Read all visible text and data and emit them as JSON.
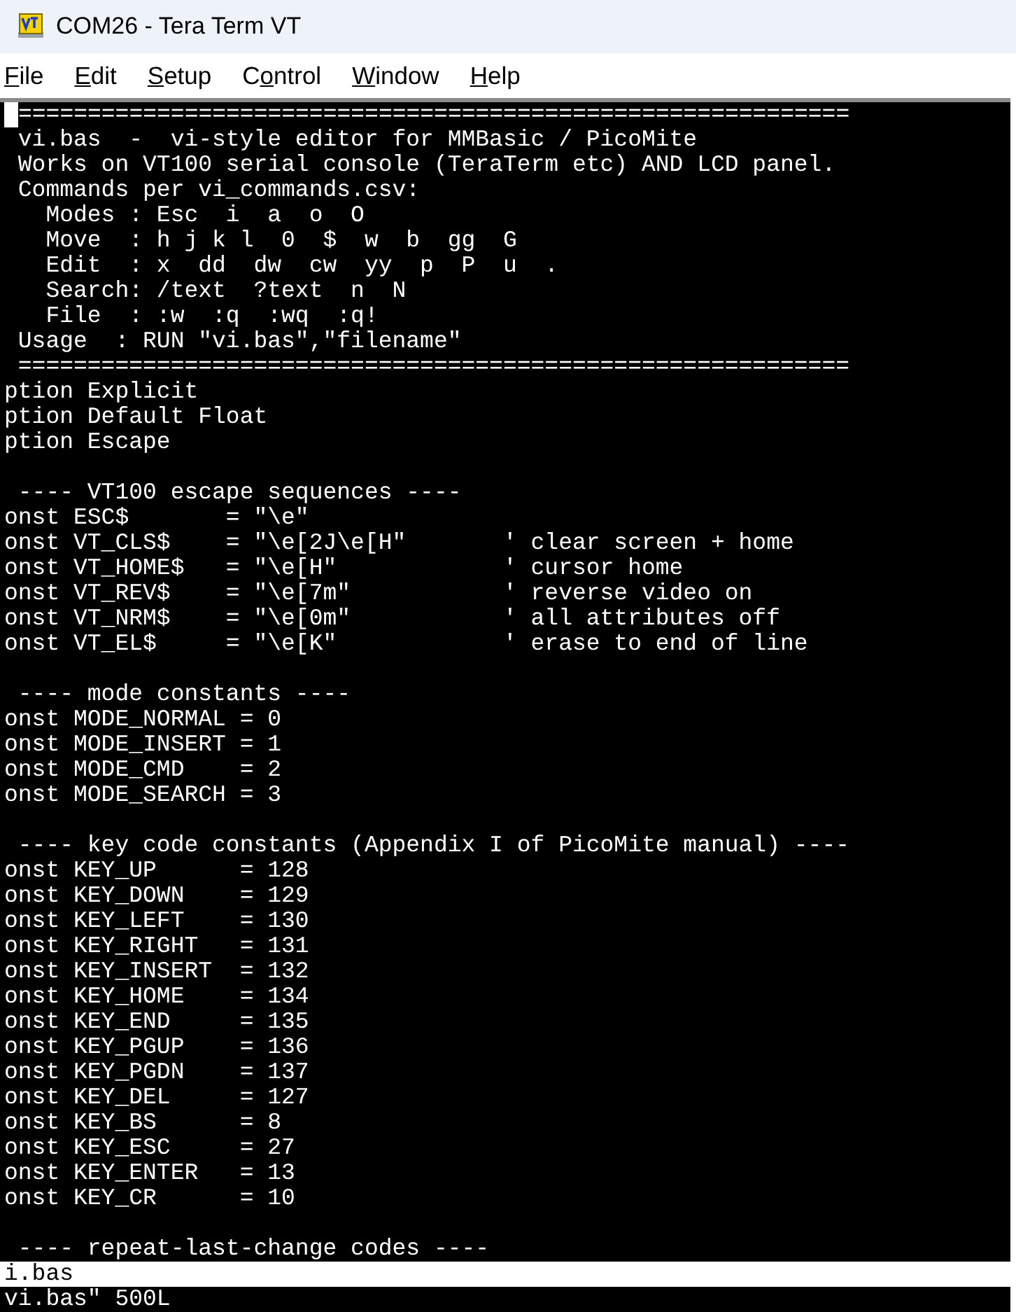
{
  "window": {
    "title": "COM26 - Tera Term VT"
  },
  "menu": [
    {
      "key": "F",
      "post": "ile"
    },
    {
      "key": "E",
      "post": "dit"
    },
    {
      "key": "S",
      "post": "etup"
    },
    {
      "pre": "C",
      "key": "o",
      "post": "ntrol"
    },
    {
      "key": "W",
      "post": "indow"
    },
    {
      "key": "H",
      "post": "elp"
    }
  ],
  "terminal": {
    "lines": [
      {
        "kind": "cursor_line",
        "text": "============================================================"
      },
      {
        "kind": "text",
        "text": " vi.bas  -  vi-style editor for MMBasic / PicoMite"
      },
      {
        "kind": "text",
        "text": " Works on VT100 serial console (TeraTerm etc) AND LCD panel."
      },
      {
        "kind": "text",
        "text": " Commands per vi_commands.csv:"
      },
      {
        "kind": "text",
        "text": "   Modes : Esc  i  a  o  O"
      },
      {
        "kind": "text",
        "text": "   Move  : h j k l  0  $  w  b  gg  G"
      },
      {
        "kind": "text",
        "text": "   Edit  : x  dd  dw  cw  yy  p  P  u  ."
      },
      {
        "kind": "text",
        "text": "   Search: /text  ?text  n  N"
      },
      {
        "kind": "text",
        "text": "   File  : :w  :q  :wq  :q!"
      },
      {
        "kind": "text",
        "text": " Usage  : RUN \"vi.bas\",\"filename\""
      },
      {
        "kind": "text",
        "text": " ============================================================"
      },
      {
        "kind": "text",
        "text": "ption Explicit"
      },
      {
        "kind": "text",
        "text": "ption Default Float"
      },
      {
        "kind": "text",
        "text": "ption Escape"
      },
      {
        "kind": "blank"
      },
      {
        "kind": "text",
        "text": " ---- VT100 escape sequences ----"
      },
      {
        "kind": "text",
        "text": "onst ESC$       = \"\\e\""
      },
      {
        "kind": "text",
        "text": "onst VT_CLS$    = \"\\e[2J\\e[H\"       ' clear screen + home"
      },
      {
        "kind": "text",
        "text": "onst VT_HOME$   = \"\\e[H\"            ' cursor home"
      },
      {
        "kind": "text",
        "text": "onst VT_REV$    = \"\\e[7m\"           ' reverse video on"
      },
      {
        "kind": "text",
        "text": "onst VT_NRM$    = \"\\e[0m\"           ' all attributes off"
      },
      {
        "kind": "text",
        "text": "onst VT_EL$     = \"\\e[K\"            ' erase to end of line"
      },
      {
        "kind": "blank"
      },
      {
        "kind": "text",
        "text": " ---- mode constants ----"
      },
      {
        "kind": "text",
        "text": "onst MODE_NORMAL = 0"
      },
      {
        "kind": "text",
        "text": "onst MODE_INSERT = 1"
      },
      {
        "kind": "text",
        "text": "onst MODE_CMD    = 2"
      },
      {
        "kind": "text",
        "text": "onst MODE_SEARCH = 3"
      },
      {
        "kind": "blank"
      },
      {
        "kind": "text",
        "text": " ---- key code constants (Appendix I of PicoMite manual) ----"
      },
      {
        "kind": "text",
        "text": "onst KEY_UP      = 128"
      },
      {
        "kind": "text",
        "text": "onst KEY_DOWN    = 129"
      },
      {
        "kind": "text",
        "text": "onst KEY_LEFT    = 130"
      },
      {
        "kind": "text",
        "text": "onst KEY_RIGHT   = 131"
      },
      {
        "kind": "text",
        "text": "onst KEY_INSERT  = 132"
      },
      {
        "kind": "text",
        "text": "onst KEY_HOME    = 134"
      },
      {
        "kind": "text",
        "text": "onst KEY_END     = 135"
      },
      {
        "kind": "text",
        "text": "onst KEY_PGUP    = 136"
      },
      {
        "kind": "text",
        "text": "onst KEY_PGDN    = 137"
      },
      {
        "kind": "text",
        "text": "onst KEY_DEL     = 127"
      },
      {
        "kind": "text",
        "text": "onst KEY_BS      = 8"
      },
      {
        "kind": "text",
        "text": "onst KEY_ESC     = 27"
      },
      {
        "kind": "text",
        "text": "onst KEY_ENTER   = 13"
      },
      {
        "kind": "text",
        "text": "onst KEY_CR      = 10"
      },
      {
        "kind": "blank"
      },
      {
        "kind": "text",
        "text": " ---- repeat-last-change codes ----"
      },
      {
        "kind": "reverse",
        "text": "i.bas"
      },
      {
        "kind": "text",
        "text": "vi.bas\" 500L"
      }
    ]
  }
}
